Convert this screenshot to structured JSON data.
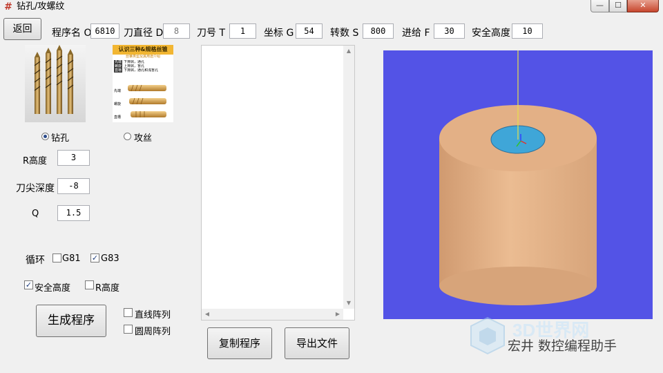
{
  "window": {
    "title": "钻孔/攻螺纹",
    "icon": "hash-icon",
    "min_glyph": "—",
    "max_glyph": "☐",
    "close_glyph": "✕"
  },
  "toolbar": {
    "back_label": "返回",
    "program_name": {
      "label": "程序名 O",
      "value": "6810"
    },
    "tool_diameter": {
      "label": "刀直径 D",
      "value": "8"
    },
    "tool_number": {
      "label": "刀号 T",
      "value": "1"
    },
    "coordinate": {
      "label": "坐标 G",
      "value": "54"
    },
    "speed": {
      "label": "转数 S",
      "value": "800"
    },
    "feed": {
      "label": "进给 F",
      "value": "30"
    },
    "safe_height": {
      "label": "安全高度",
      "value": "10"
    }
  },
  "mode": {
    "drill_label": "钻孔",
    "tap_label": "攻丝",
    "selected": "drill"
  },
  "tap_card": {
    "title": "认识三种&规格丝锥",
    "subtitle": "丝锥类型及其用途介绍",
    "rows": [
      [
        "先端",
        "下排屑，通孔"
      ],
      [
        "螺旋",
        "上排屑，盲孔"
      ],
      [
        "直槽",
        "下排屑，通孔和浅盲孔"
      ]
    ],
    "tag_labels": [
      "先端",
      "螺旋",
      "直槽"
    ]
  },
  "params": {
    "r_height": {
      "label": "R高度",
      "value": "3"
    },
    "tip_depth": {
      "label": "刀尖深度",
      "value": "-8"
    },
    "q": {
      "label": "Q",
      "value": "1.5"
    }
  },
  "cycle": {
    "label": "循环",
    "g81_label": "G81",
    "g81_checked": false,
    "g83_label": "G83",
    "g83_checked": true
  },
  "height_opts": {
    "safe_label": "安全高度",
    "safe_checked": true,
    "r_label": "R高度",
    "r_checked": false
  },
  "array_opts": {
    "linear_label": "直线阵列",
    "linear_checked": false,
    "circular_label": "圆周阵列",
    "circular_checked": false
  },
  "actions": {
    "generate_label": "生成程序",
    "copy_label": "复制程序",
    "export_label": "导出文件"
  },
  "code_text": "",
  "watermark": {
    "brand": "3D世界网",
    "caption": "宏井 数控编程助手"
  },
  "colors": {
    "viewport_bg": "#5353e6",
    "cylinder": "#e3b086",
    "hole": "#3fa6d8"
  }
}
